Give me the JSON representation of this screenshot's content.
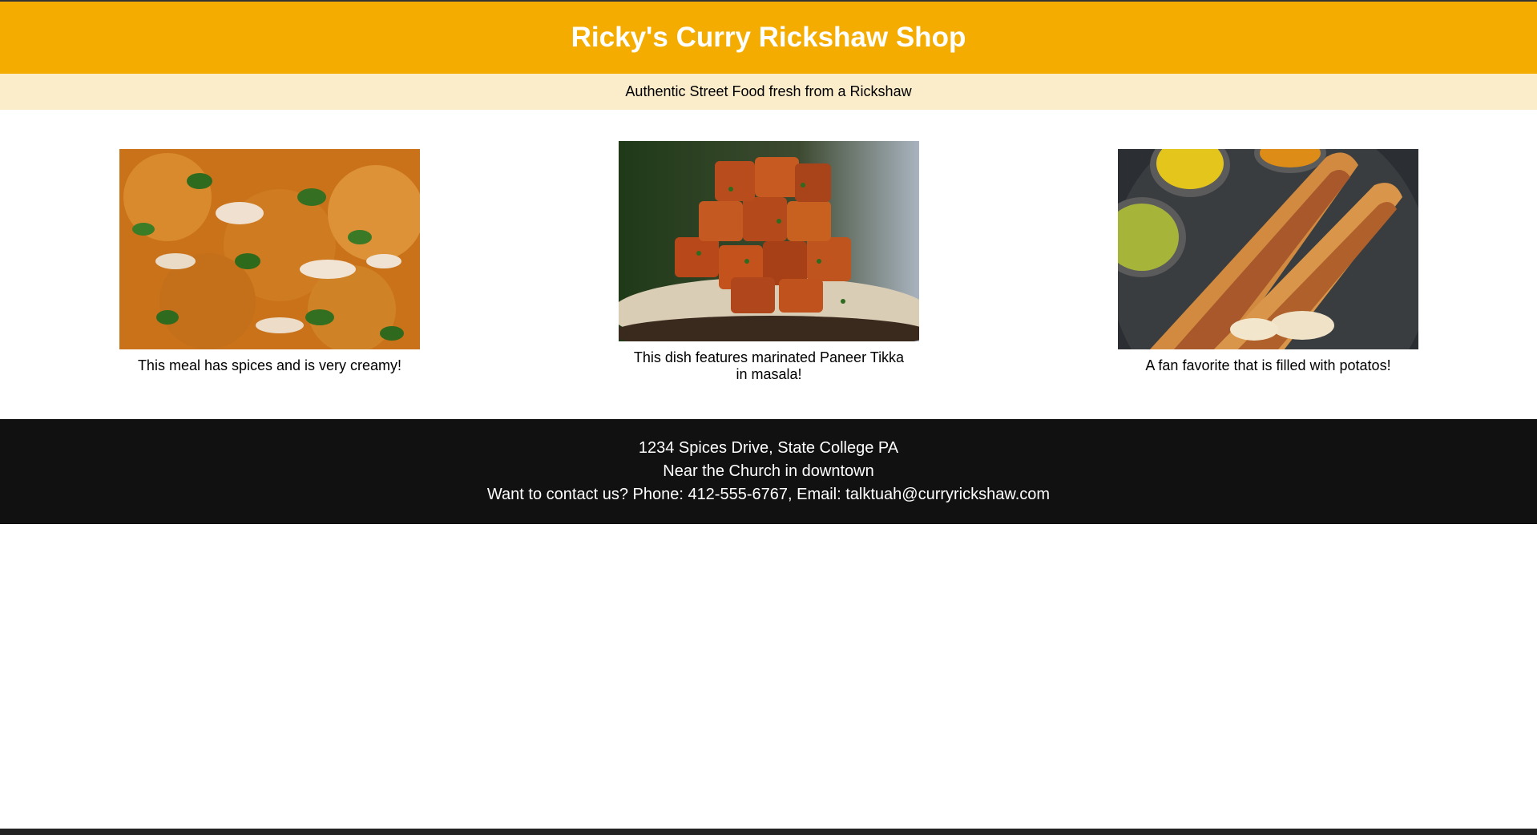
{
  "header": {
    "title": "Ricky's Curry Rickshaw Shop",
    "background_color": "#f4ac00"
  },
  "tagline": {
    "text": "Authentic Street Food fresh from a Rickshaw",
    "background_color": "#fcedca"
  },
  "dishes": [
    {
      "image": "butter-chicken-curry-photo",
      "caption": "This meal has spices and is very creamy!"
    },
    {
      "image": "paneer-tikka-photo",
      "caption": "This dish features marinated Paneer Tikka in masala!"
    },
    {
      "image": "masala-dosa-photo",
      "caption": "A fan favorite that is filled with potatos!"
    }
  ],
  "footer": {
    "address": "1234 Spices Drive, State College PA",
    "landmark": "Near the Church in downtown",
    "contact": "Want to contact us? Phone: 412-555-6767, Email: talktuah@curryrickshaw.com",
    "background_color": "#111111"
  }
}
